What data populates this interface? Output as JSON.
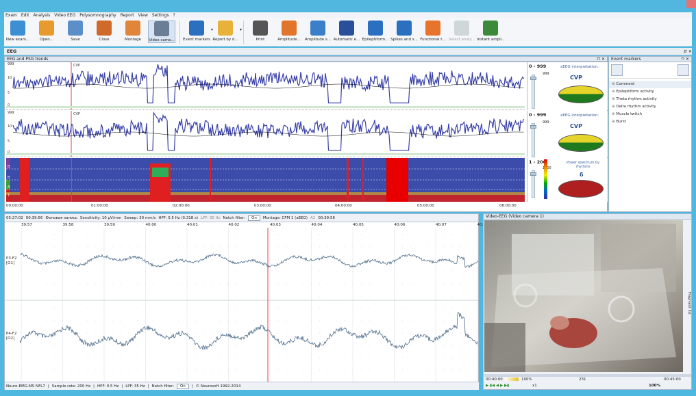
{
  "menu": [
    "Exam",
    "Edit",
    "Analysis",
    "Video EEG",
    "Polysomnography",
    "Report",
    "View",
    "Settings",
    "?"
  ],
  "toolbar": [
    {
      "label": "New exam...",
      "icon": "new-exam-icon",
      "color": "#3d8fd4"
    },
    {
      "label": "Open...",
      "icon": "open-icon",
      "color": "#e89a2f"
    },
    {
      "label": "Save",
      "icon": "save-icon",
      "color": "#5b8fc8"
    },
    {
      "label": "Close",
      "icon": "close-icon",
      "color": "#d06a2a"
    },
    {
      "label": "Montage",
      "icon": "montage-icon",
      "color": "#e0853a"
    },
    {
      "label": "Video came...",
      "icon": "video-camera-icon",
      "color": "#6a7f96"
    },
    {
      "label": "Event markers",
      "icon": "event-markers-icon",
      "color": "#2a6fc0"
    },
    {
      "label": "Report by d...",
      "icon": "report-icon",
      "color": "#e7b23a"
    },
    {
      "label": "Print",
      "icon": "print-icon",
      "color": "#555"
    },
    {
      "label": "Amplitude...",
      "icon": "amplitude-map-icon",
      "color": "#e0752b"
    },
    {
      "label": "Amplitude s...",
      "icon": "amplitude-spectrum-icon",
      "color": "#3a7fc8"
    },
    {
      "label": "Automatic e...",
      "icon": "automatic-analysis-icon",
      "color": "#2a4f9a"
    },
    {
      "label": "Epileptiform...",
      "icon": "epileptiform-icon",
      "color": "#2a6fc0"
    },
    {
      "label": "Spikes and s...",
      "icon": "spikes-icon",
      "color": "#2a6fc0"
    },
    {
      "label": "Functional t...",
      "icon": "functional-tests-icon",
      "color": "#e8732a"
    },
    {
      "label": "Select analy...",
      "icon": "select-analysis-icon",
      "color": "#9aa"
    },
    {
      "label": "Instant ampli...",
      "icon": "instant-amplitude-icon",
      "color": "#3a8a3a"
    }
  ],
  "eeg_panel_title": "EEG",
  "trends_title": "EEG and PSG trends",
  "trends": [
    {
      "label": "CVP",
      "range": "0 - 999",
      "scale": "999",
      "interp_title": "aEEG interpretation:",
      "interp": "CVP",
      "yticks": [
        "999",
        "10",
        "5",
        "0"
      ]
    },
    {
      "label": "CVP",
      "range": "0 - 999",
      "scale": "999",
      "interp_title": "aEEG interpretation:",
      "interp": "CVP",
      "yticks": [
        "999",
        "10",
        "5",
        "0"
      ]
    }
  ],
  "spectrum": {
    "range": "1 - 200",
    "scale": "1000",
    "title": "Power spectrum by rhythms",
    "rhythm": "δ",
    "bands": [
      "B",
      "θ",
      "A",
      "T"
    ]
  },
  "time_axis": [
    "00:00:00",
    "01:00:00",
    "02:00:00",
    "03:00:00",
    "04:00:00",
    "05:00:00",
    "06:00:00"
  ],
  "event_markers": {
    "title": "Event markers",
    "items": [
      "Comment",
      "Epileptiform activity",
      "Theta rhythm activity",
      "Delta rhythm activity",
      "Muscle twitch",
      "Burst"
    ]
  },
  "eeg_toolbar": {
    "time": "05:27:02",
    "elapsed": "00:39:56",
    "record": "Фоновая запись",
    "sensitivity": "Sensitivity: 10 μV/mm",
    "sweep": "Sweep: 30 mm/s",
    "hpf": "HPF: 0.5 Hz (0.318 s)",
    "lpf": "LPF: 35 Hz",
    "notch": "Notch filter:",
    "notch_val": "On",
    "montage": "Montage: CFM 1 (aEEG)",
    "a1": "A1",
    "clock": "00:39:56"
  },
  "eeg_ticks": [
    "39:57",
    "39:58",
    "39:59",
    "40:00",
    "40:01",
    "40:02",
    "40:03",
    "40:04",
    "40:05",
    "40:06",
    "40:07",
    "40:08"
  ],
  "channels": [
    {
      "name": "P3-F2",
      "sub": "[O1]"
    },
    {
      "name": "P4-F2",
      "sub": "[O2]"
    }
  ],
  "status": {
    "device": "Neuro-EMG-MS NFL7",
    "rate": "Sample rate: 200 Hz",
    "hpf": "HPF: 0.5 Hz",
    "lpf": "LPF: 35 Hz",
    "notch": "Notch filter:",
    "notch_val": "On",
    "copyright": "© Neurosoft 1992-2014"
  },
  "video": {
    "title": "Video-EEG (Video camera 1)",
    "fragment_list": "Fragment list",
    "start": "00:40:00",
    "zoom": "100%",
    "frame": "231",
    "end": "00:45:00",
    "speed": "x1",
    "zoom2": "100%"
  }
}
